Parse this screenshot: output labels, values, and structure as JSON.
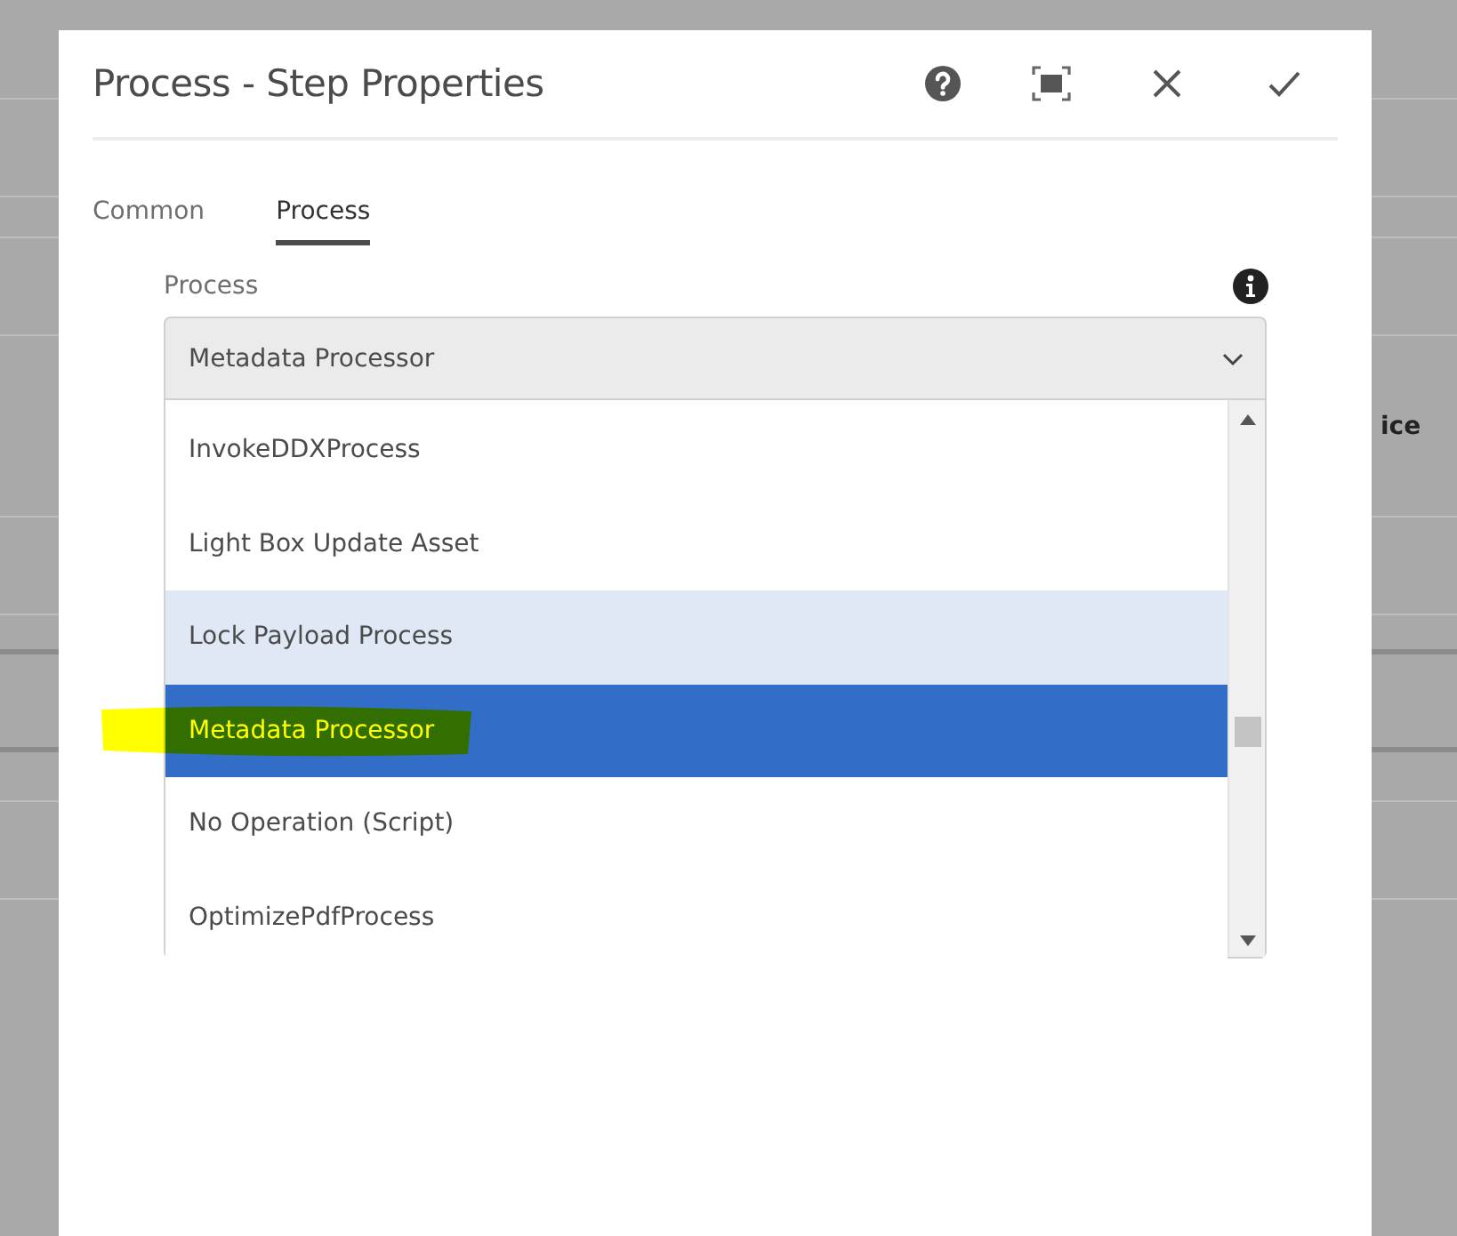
{
  "background": {
    "rows": [
      {
        "text": ""
      },
      {
        "text": ""
      },
      {
        "text": ""
      },
      {
        "text": "ice"
      },
      {
        "text": ""
      }
    ]
  },
  "dialog": {
    "title": "Process - Step Properties",
    "tabs": [
      {
        "label": "Common",
        "selected": false
      },
      {
        "label": "Process",
        "selected": true
      }
    ],
    "field": {
      "label": "Process",
      "value": "Metadata Processor",
      "options": [
        {
          "label": "InvokeDDXProcess",
          "selected": false,
          "hovered": false,
          "highlighted": false
        },
        {
          "label": "Light Box Update Asset",
          "selected": false,
          "hovered": false,
          "highlighted": false
        },
        {
          "label": "Lock Payload Process",
          "selected": false,
          "hovered": true,
          "highlighted": false
        },
        {
          "label": "Metadata Processor",
          "selected": true,
          "hovered": false,
          "highlighted": true
        },
        {
          "label": "No Operation (Script)",
          "selected": false,
          "hovered": false,
          "highlighted": false
        },
        {
          "label": "OptimizePdfProcess",
          "selected": false,
          "hovered": false,
          "highlighted": false
        }
      ]
    }
  }
}
